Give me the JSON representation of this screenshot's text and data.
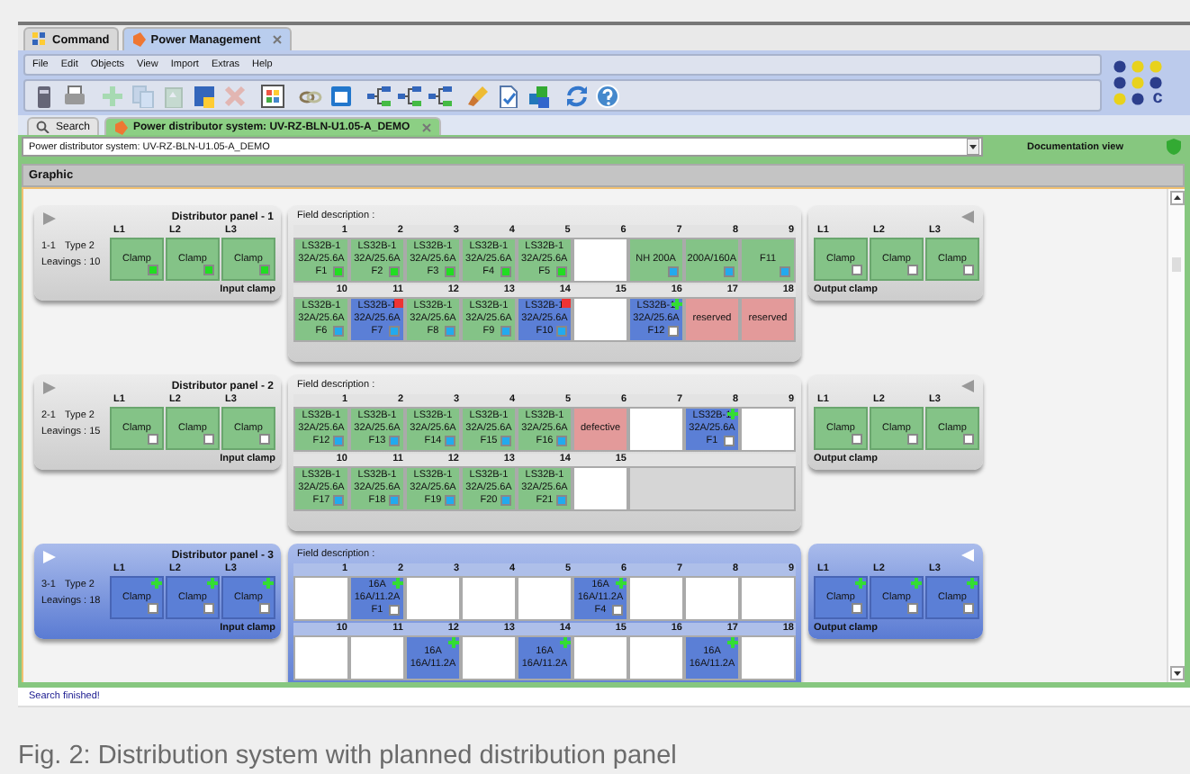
{
  "top_tabs": [
    {
      "label": "Command",
      "selected": false,
      "closable": false
    },
    {
      "label": "Power Management",
      "selected": true,
      "closable": true
    }
  ],
  "menu": [
    "File",
    "Edit",
    "Objects",
    "View",
    "Import",
    "Extras",
    "Help"
  ],
  "toolbar": [
    {
      "kind": "device",
      "disabled": false
    },
    {
      "kind": "printer",
      "disabled": false
    },
    {
      "kind": "plus",
      "disabled": true
    },
    {
      "kind": "copy",
      "disabled": true
    },
    {
      "kind": "paste",
      "disabled": true
    },
    {
      "kind": "save",
      "disabled": false
    },
    {
      "kind": "delete",
      "disabled": true
    },
    {
      "kind": "grid",
      "disabled": false
    },
    {
      "kind": "chain",
      "disabled": false
    },
    {
      "kind": "window",
      "disabled": false
    },
    {
      "kind": "network",
      "disabled": false
    },
    {
      "kind": "network",
      "disabled": false
    },
    {
      "kind": "network",
      "disabled": false
    },
    {
      "kind": "brush",
      "disabled": false
    },
    {
      "kind": "document",
      "disabled": false
    },
    {
      "kind": "cubes",
      "disabled": false
    },
    {
      "kind": "refresh",
      "disabled": false
    },
    {
      "kind": "help",
      "disabled": false
    }
  ],
  "logo": {
    "letter": "c"
  },
  "doc_tabs": [
    {
      "label": "Search",
      "selected": false,
      "closable": false
    },
    {
      "label": "Power distributor system: UV-RZ-BLN-U1.05-A_DEMO",
      "selected": true,
      "closable": true
    }
  ],
  "selector": {
    "value": "Power distributor system: UV-RZ-BLN-U1.05-A_DEMO"
  },
  "view_label": "Documentation view",
  "section_title": "Graphic",
  "panels": [
    {
      "title": "Distributor panel - 1",
      "selected": false,
      "id": "1-1",
      "type": "Type 2",
      "leavings": "Leavings : 10",
      "input_label": "Input clamp",
      "output_label": "Output clamp",
      "field_label": "Field description :",
      "inputs": [
        {
          "phase": "L1",
          "text": "Clamp",
          "indicator": {
            "color": "#22dd22"
          },
          "error": false,
          "added": false
        },
        {
          "phase": "L2",
          "text": "Clamp",
          "indicator": {
            "color": "#22dd22"
          },
          "error": false,
          "added": false
        },
        {
          "phase": "L3",
          "text": "Clamp",
          "indicator": {
            "color": "#22dd22"
          },
          "error": false,
          "added": false
        }
      ],
      "outputs": [
        {
          "phase": "L1",
          "text": "Clamp",
          "indicator": {
            "color": "#ffffff"
          },
          "error": false,
          "added": false
        },
        {
          "phase": "L2",
          "text": "Clamp",
          "indicator": {
            "color": "#ffffff"
          },
          "error": false,
          "added": false
        },
        {
          "phase": "L3",
          "text": "Clamp",
          "indicator": {
            "color": "#ffffff"
          },
          "error": false,
          "added": false
        }
      ],
      "rows": [
        [
          {
            "kind": "field",
            "number": "1",
            "color": "#84c387",
            "lines": [
              "LS32B-1",
              "32A/25.6A",
              "F1"
            ],
            "indicator": {
              "color": "#22dd22"
            },
            "error": false,
            "added": false
          },
          {
            "kind": "field",
            "number": "2",
            "color": "#84c387",
            "lines": [
              "LS32B-1",
              "32A/25.6A",
              "F2"
            ],
            "indicator": {
              "color": "#22dd22"
            },
            "error": false,
            "added": false
          },
          {
            "kind": "field",
            "number": "3",
            "color": "#84c387",
            "lines": [
              "LS32B-1",
              "32A/25.6A",
              "F3"
            ],
            "indicator": {
              "color": "#22dd22"
            },
            "error": false,
            "added": false
          },
          {
            "kind": "field",
            "number": "4",
            "color": "#84c387",
            "lines": [
              "LS32B-1",
              "32A/25.6A",
              "F4"
            ],
            "indicator": {
              "color": "#22dd22"
            },
            "error": false,
            "added": false
          },
          {
            "kind": "field",
            "number": "5",
            "color": "#84c387",
            "lines": [
              "LS32B-1",
              "32A/25.6A",
              "F5"
            ],
            "indicator": {
              "color": "#22dd22"
            },
            "error": false,
            "added": false
          },
          {
            "kind": "field",
            "number": "6",
            "color": "#ffffff",
            "error": false,
            "added": false
          },
          {
            "kind": "field",
            "number": "7",
            "color": "#84c387",
            "lines": [
              "NH 200A"
            ],
            "indicator": {
              "color": "#22aaee"
            },
            "error": false,
            "added": false
          },
          {
            "kind": "field",
            "number": "8",
            "color": "#84c387",
            "lines": [
              "200A/160A"
            ],
            "indicator": {
              "color": "#22aaee"
            },
            "error": false,
            "added": false
          },
          {
            "kind": "field",
            "number": "9",
            "color": "#84c387",
            "lines": [
              "F11"
            ],
            "indicator": {
              "color": "#22aaee"
            },
            "error": false,
            "added": false
          }
        ],
        [
          {
            "kind": "field",
            "number": "10",
            "color": "#84c387",
            "lines": [
              "LS32B-1",
              "32A/25.6A",
              "F6"
            ],
            "indicator": {
              "color": "#22aaee"
            },
            "error": false,
            "added": false
          },
          {
            "kind": "field",
            "number": "11",
            "color": "#5b7fd6",
            "lines": [
              "LS32B-1",
              "32A/25.6A",
              "F7"
            ],
            "indicator": {
              "color": "#22aaee"
            },
            "error": true,
            "added": false
          },
          {
            "kind": "field",
            "number": "12",
            "color": "#84c387",
            "lines": [
              "LS32B-1",
              "32A/25.6A",
              "F8"
            ],
            "indicator": {
              "color": "#22aaee"
            },
            "error": false,
            "added": false
          },
          {
            "kind": "field",
            "number": "13",
            "color": "#84c387",
            "lines": [
              "LS32B-1",
              "32A/25.6A",
              "F9"
            ],
            "indicator": {
              "color": "#22aaee"
            },
            "error": false,
            "added": false
          },
          {
            "kind": "field",
            "number": "14",
            "color": "#5b7fd6",
            "lines": [
              "LS32B-1",
              "32A/25.6A",
              "F10"
            ],
            "indicator": {
              "color": "#22aaee"
            },
            "error": true,
            "added": false
          },
          {
            "kind": "field",
            "number": "15",
            "color": "#ffffff",
            "error": false,
            "added": false
          },
          {
            "kind": "field",
            "number": "16",
            "color": "#5b7fd6",
            "lines": [
              "LS32B-1",
              "32A/25.6A",
              "F12"
            ],
            "indicator": {
              "color": "#ffffff"
            },
            "error": false,
            "added": true
          },
          {
            "kind": "field",
            "number": "17",
            "color": "#e39a9a",
            "lines": [
              "reserved"
            ],
            "error": false,
            "added": false
          },
          {
            "kind": "field",
            "number": "18",
            "color": "#e39a9a",
            "lines": [
              "reserved"
            ],
            "error": false,
            "added": false
          }
        ]
      ]
    },
    {
      "title": "Distributor panel - 2",
      "selected": false,
      "id": "2-1",
      "type": "Type 2",
      "leavings": "Leavings : 15",
      "input_label": "Input clamp",
      "output_label": "Output clamp",
      "field_label": "Field description :",
      "inputs": [
        {
          "phase": "L1",
          "text": "Clamp",
          "indicator": {
            "color": "#ffffff"
          },
          "error": false,
          "added": false
        },
        {
          "phase": "L2",
          "text": "Clamp",
          "indicator": {
            "color": "#ffffff"
          },
          "error": false,
          "added": false
        },
        {
          "phase": "L3",
          "text": "Clamp",
          "indicator": {
            "color": "#ffffff"
          },
          "error": false,
          "added": false
        }
      ],
      "outputs": [
        {
          "phase": "L1",
          "text": "Clamp",
          "indicator": {
            "color": "#ffffff"
          },
          "error": false,
          "added": false
        },
        {
          "phase": "L2",
          "text": "Clamp",
          "indicator": {
            "color": "#ffffff"
          },
          "error": false,
          "added": false
        },
        {
          "phase": "L3",
          "text": "Clamp",
          "indicator": {
            "color": "#ffffff"
          },
          "error": false,
          "added": false
        }
      ],
      "rows": [
        [
          {
            "kind": "field",
            "number": "1",
            "color": "#84c387",
            "lines": [
              "LS32B-1",
              "32A/25.6A",
              "F12"
            ],
            "indicator": {
              "color": "#22aaee"
            },
            "error": false,
            "added": false
          },
          {
            "kind": "field",
            "number": "2",
            "color": "#84c387",
            "lines": [
              "LS32B-1",
              "32A/25.6A",
              "F13"
            ],
            "indicator": {
              "color": "#22aaee"
            },
            "error": false,
            "added": false
          },
          {
            "kind": "field",
            "number": "3",
            "color": "#84c387",
            "lines": [
              "LS32B-1",
              "32A/25.6A",
              "F14"
            ],
            "indicator": {
              "color": "#22aaee"
            },
            "error": false,
            "added": false
          },
          {
            "kind": "field",
            "number": "4",
            "color": "#84c387",
            "lines": [
              "LS32B-1",
              "32A/25.6A",
              "F15"
            ],
            "indicator": {
              "color": "#22aaee"
            },
            "error": false,
            "added": false
          },
          {
            "kind": "field",
            "number": "5",
            "color": "#84c387",
            "lines": [
              "LS32B-1",
              "32A/25.6A",
              "F16"
            ],
            "indicator": {
              "color": "#22aaee"
            },
            "error": false,
            "added": false
          },
          {
            "kind": "field",
            "number": "6",
            "color": "#e39a9a",
            "lines": [
              "defective"
            ],
            "error": false,
            "added": false
          },
          {
            "kind": "field",
            "number": "7",
            "color": "#ffffff",
            "error": false,
            "added": false
          },
          {
            "kind": "field",
            "number": "8",
            "color": "#5b7fd6",
            "lines": [
              "LS32B-1",
              "32A/25.6A",
              "F1"
            ],
            "indicator": {
              "color": "#ffffff"
            },
            "error": false,
            "added": true
          },
          {
            "kind": "field",
            "number": "9",
            "color": "#ffffff",
            "error": false,
            "added": false
          }
        ],
        [
          {
            "kind": "field",
            "number": "10",
            "color": "#84c387",
            "lines": [
              "LS32B-1",
              "32A/25.6A",
              "F17"
            ],
            "indicator": {
              "color": "#22aaee"
            },
            "error": false,
            "added": false
          },
          {
            "kind": "field",
            "number": "11",
            "color": "#84c387",
            "lines": [
              "LS32B-1",
              "32A/25.6A",
              "F18"
            ],
            "indicator": {
              "color": "#22aaee"
            },
            "error": false,
            "added": false
          },
          {
            "kind": "field",
            "number": "12",
            "color": "#84c387",
            "lines": [
              "LS32B-1",
              "32A/25.6A",
              "F19"
            ],
            "indicator": {
              "color": "#22aaee"
            },
            "error": false,
            "added": false
          },
          {
            "kind": "field",
            "number": "13",
            "color": "#84c387",
            "lines": [
              "LS32B-1",
              "32A/25.6A",
              "F20"
            ],
            "indicator": {
              "color": "#22aaee"
            },
            "error": false,
            "added": false
          },
          {
            "kind": "field",
            "number": "14",
            "color": "#84c387",
            "lines": [
              "LS32B-1",
              "32A/25.6A",
              "F21"
            ],
            "indicator": {
              "color": "#22aaee"
            },
            "error": false,
            "added": false
          },
          {
            "kind": "field",
            "number": "15",
            "color": "#ffffff",
            "error": false,
            "added": false
          },
          {
            "kind": "vacant"
          }
        ]
      ]
    },
    {
      "title": "Distributor panel - 3",
      "selected": true,
      "id": "3-1",
      "type": "Type 2",
      "leavings": "Leavings : 18",
      "input_label": "Input clamp",
      "output_label": "Output clamp",
      "field_label": "Field description :",
      "inputs": [
        {
          "phase": "L1",
          "text": "Clamp",
          "indicator": {
            "color": "#ffffff"
          },
          "error": false,
          "added": true
        },
        {
          "phase": "L2",
          "text": "Clamp",
          "indicator": {
            "color": "#ffffff"
          },
          "error": false,
          "added": true
        },
        {
          "phase": "L3",
          "text": "Clamp",
          "indicator": {
            "color": "#ffffff"
          },
          "error": false,
          "added": true
        }
      ],
      "outputs": [
        {
          "phase": "L1",
          "text": "Clamp",
          "indicator": {
            "color": "#ffffff"
          },
          "error": false,
          "added": true
        },
        {
          "phase": "L2",
          "text": "Clamp",
          "indicator": {
            "color": "#ffffff"
          },
          "error": false,
          "added": true
        },
        {
          "phase": "L3",
          "text": "Clamp",
          "indicator": {
            "color": "#ffffff"
          },
          "error": false,
          "added": true
        }
      ],
      "rows": [
        [
          {
            "kind": "field",
            "number": "1",
            "color": "#ffffff",
            "error": false,
            "added": false
          },
          {
            "kind": "field",
            "number": "2",
            "color": "#5b7fd6",
            "lines": [
              "16A",
              "16A/11.2A",
              "F1"
            ],
            "indicator": {
              "color": "#ffffff"
            },
            "error": false,
            "added": true
          },
          {
            "kind": "field",
            "number": "3",
            "color": "#ffffff",
            "error": false,
            "added": false
          },
          {
            "kind": "field",
            "number": "4",
            "color": "#ffffff",
            "error": false,
            "added": false
          },
          {
            "kind": "field",
            "number": "5",
            "color": "#ffffff",
            "error": false,
            "added": false
          },
          {
            "kind": "field",
            "number": "6",
            "color": "#5b7fd6",
            "lines": [
              "16A",
              "16A/11.2A",
              "F4"
            ],
            "indicator": {
              "color": "#ffffff"
            },
            "error": false,
            "added": true
          },
          {
            "kind": "field",
            "number": "7",
            "color": "#ffffff",
            "error": false,
            "added": false
          },
          {
            "kind": "field",
            "number": "8",
            "color": "#ffffff",
            "error": false,
            "added": false
          },
          {
            "kind": "field",
            "number": "9",
            "color": "#ffffff",
            "error": false,
            "added": false
          }
        ],
        [
          {
            "kind": "field",
            "number": "10",
            "color": "#ffffff",
            "error": false,
            "added": false
          },
          {
            "kind": "field",
            "number": "11",
            "color": "#ffffff",
            "error": false,
            "added": false
          },
          {
            "kind": "field",
            "number": "12",
            "color": "#5b7fd6",
            "lines": [
              "16A",
              "16A/11.2A"
            ],
            "error": false,
            "added": true
          },
          {
            "kind": "field",
            "number": "13",
            "color": "#ffffff",
            "error": false,
            "added": false
          },
          {
            "kind": "field",
            "number": "14",
            "color": "#5b7fd6",
            "lines": [
              "16A",
              "16A/11.2A"
            ],
            "error": false,
            "added": true
          },
          {
            "kind": "field",
            "number": "15",
            "color": "#ffffff",
            "error": false,
            "added": false
          },
          {
            "kind": "field",
            "number": "16",
            "color": "#ffffff",
            "error": false,
            "added": false
          },
          {
            "kind": "field",
            "number": "17",
            "color": "#5b7fd6",
            "lines": [
              "16A",
              "16A/11.2A"
            ],
            "error": false,
            "added": true
          },
          {
            "kind": "field",
            "number": "18",
            "color": "#ffffff",
            "error": false,
            "added": false
          }
        ]
      ]
    }
  ],
  "status_bar": "Search finished!",
  "caption": "Fig. 2: Distribution system with planned distribution panel"
}
